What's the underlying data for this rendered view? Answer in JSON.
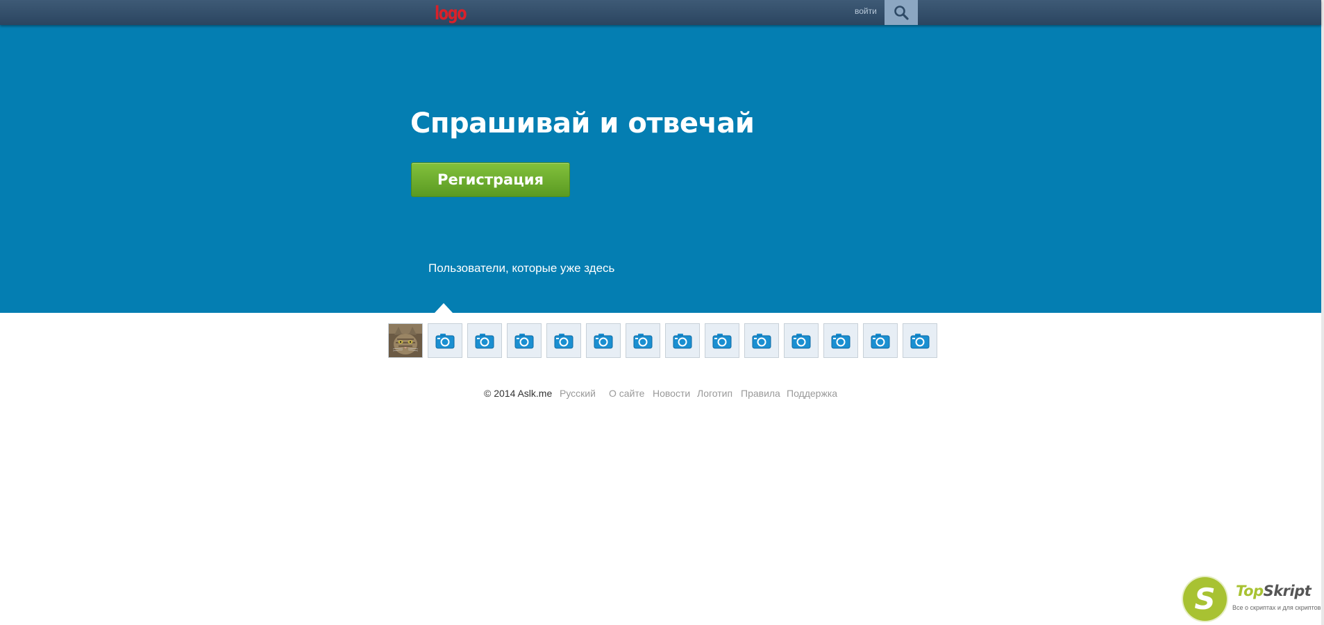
{
  "header": {
    "logo_text": "logo",
    "login_label": "войти",
    "search_icon": "search-icon",
    "colors": {
      "bar": "#34506c",
      "logo": "#d9212a",
      "search_bg": "#8ca7c2"
    }
  },
  "hero": {
    "title": "Спрашивай и отвечай",
    "register_label": "Регистрация",
    "users_caption": "Пользователи, которые уже здесь",
    "colors": {
      "background": "#047eb2",
      "button": "#6aab2c"
    }
  },
  "users": {
    "avatar_icons": [
      "cat-photo",
      "camera-icon",
      "camera-icon",
      "camera-icon",
      "camera-icon",
      "camera-icon",
      "camera-icon",
      "camera-icon",
      "camera-icon",
      "camera-icon",
      "camera-icon",
      "camera-icon",
      "camera-icon",
      "camera-icon"
    ]
  },
  "footer": {
    "copyright": "© 2014 Aslk.me",
    "language": "Русский",
    "links": [
      "О сайте",
      "Новости",
      "Логотип",
      "Правила",
      "Поддержка"
    ]
  },
  "watermark": {
    "badge_letter": "S",
    "brand_part1": "Top",
    "brand_part2": "Skript",
    "tagline": "Все о скриптах и для скриптов...",
    "colors": {
      "badge": "#a8c232"
    }
  }
}
